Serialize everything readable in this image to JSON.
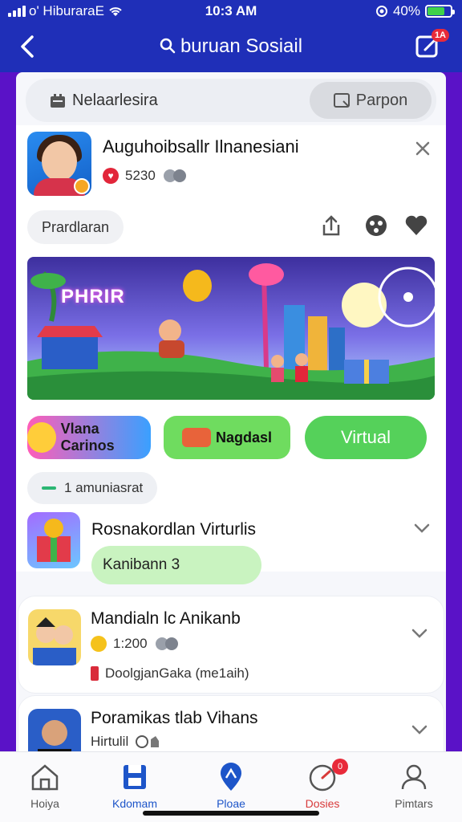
{
  "status_bar": {
    "carrier": "o' HiburaraE",
    "time": "10:3 AM",
    "battery": "40%",
    "battery_level": 0.7
  },
  "nav": {
    "title": "buruan Sosiail",
    "compose_badge": "1A"
  },
  "tabs": {
    "left_label": "Nelaarlesira",
    "right_label": "Parpon"
  },
  "post": {
    "author": "Auguhoibsallr Ilnanesiani",
    "count": "5230",
    "tag": "Prardlaran",
    "banner_text": "PHRIR"
  },
  "chips": [
    {
      "label": "Vlana Carinos"
    },
    {
      "label": "Nagdasl"
    },
    {
      "label": "Virtual"
    }
  ],
  "members": "1 amuniasrat",
  "list": [
    {
      "title": "Rosnakordlan Virturlis",
      "pill": "Kanibann 3"
    },
    {
      "title": "Mandialn lc Anikanb",
      "count": "1:200",
      "sub": "DoolgjanGaka (me1aih)"
    },
    {
      "title": "Poramikas tlab Vihans",
      "title2": "Hirtulil"
    }
  ],
  "bottom_tabs": [
    {
      "label": "Hoiya",
      "icon": "home-icon"
    },
    {
      "label": "Kdomam",
      "icon": "save-icon"
    },
    {
      "label": "Ploae",
      "icon": "location-icon"
    },
    {
      "label": "Dosies",
      "icon": "gauge-icon",
      "badge": "0"
    },
    {
      "label": "Pimtars",
      "icon": "profile-icon"
    }
  ],
  "colors": {
    "primary": "#1f2fb8",
    "accent_purple": "#5a12c7",
    "green": "#55d15a"
  }
}
